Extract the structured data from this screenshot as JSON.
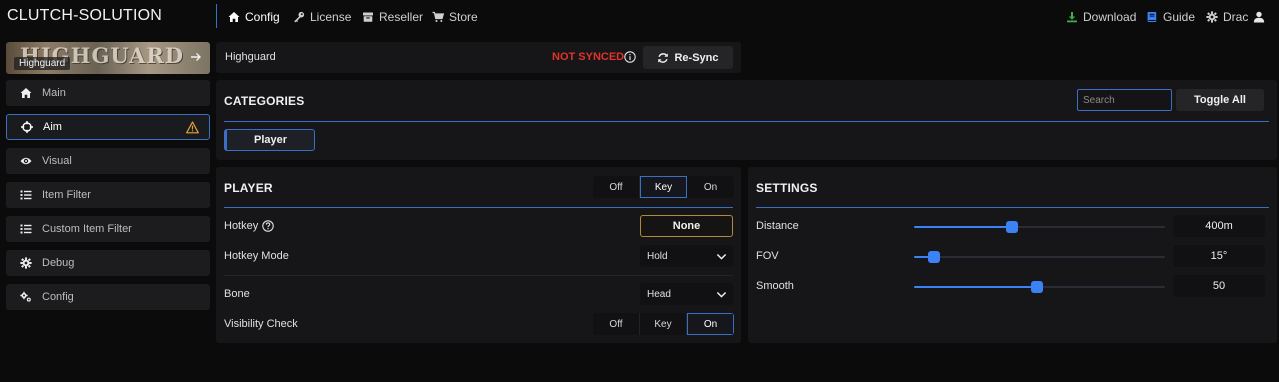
{
  "app": {
    "brand": "CLUTCH-SOLUTION"
  },
  "nav": {
    "config": "Config",
    "license": "License",
    "reseller": "Reseller",
    "store": "Store",
    "download": "Download",
    "guide": "Guide",
    "user": "Drac"
  },
  "sidebar": {
    "banner_label": "Highguard",
    "banner_art_text": "HIGHGUARD",
    "items": [
      {
        "label": "Main",
        "icon": "home-icon"
      },
      {
        "label": "Aim",
        "icon": "crosshair-icon",
        "active": true,
        "warning": true
      },
      {
        "label": "Visual",
        "icon": "eye-icon"
      },
      {
        "label": "Item Filter",
        "icon": "list-icon"
      },
      {
        "label": "Custom Item Filter",
        "icon": "list-icon"
      },
      {
        "label": "Debug",
        "icon": "gear-icon"
      },
      {
        "label": "Config",
        "icon": "gears-icon"
      }
    ]
  },
  "profile": {
    "name": "Highguard",
    "sync_status": "NOT SYNCED",
    "resync_label": "Re-Sync"
  },
  "categories": {
    "title": "CATEGORIES",
    "search_placeholder": "Search",
    "toggle_all_label": "Toggle All",
    "items": [
      "Player"
    ]
  },
  "player": {
    "title": "PLAYER",
    "mode_options": [
      "Off",
      "Key",
      "On"
    ],
    "mode_selected": "Key",
    "hotkey_label": "Hotkey",
    "hotkey_value": "None",
    "hotkey_mode_label": "Hotkey Mode",
    "hotkey_mode_value": "Hold",
    "bone_label": "Bone",
    "bone_value": "Head",
    "visibility_label": "Visibility Check",
    "visibility_options": [
      "Off",
      "Key",
      "On"
    ],
    "visibility_selected": "On"
  },
  "settings": {
    "title": "SETTINGS",
    "rows": [
      {
        "label": "Distance",
        "value": "400m",
        "fraction": 0.39
      },
      {
        "label": "FOV",
        "value": "15°",
        "fraction": 0.08
      },
      {
        "label": "Smooth",
        "value": "50",
        "fraction": 0.49
      }
    ]
  },
  "colors": {
    "accent": "#3b82f6",
    "accent_border": "#3b6fc4",
    "error": "#e0332a",
    "warning": "#e8a33a",
    "download_icon": "#3fae49",
    "guide_icon": "#3b82f6",
    "hotkey_border": "#b0893a"
  }
}
